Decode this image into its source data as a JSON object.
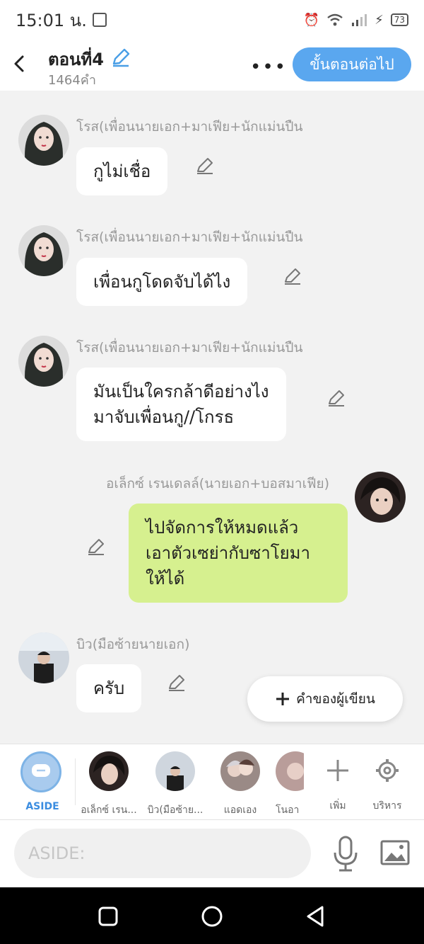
{
  "status": {
    "time": "15:01 น.",
    "battery": "73"
  },
  "header": {
    "title": "ตอนที่4",
    "word_count": "1464คำ",
    "more": "•••",
    "next_label": "ขั้นตอนต่อไป"
  },
  "messages": [
    {
      "name": "โรส(เพื่อนนายเอก+มาเฟีย+นักแม่นปืน",
      "lines": [
        "กูไม่เชื่อ"
      ]
    },
    {
      "name": "โรส(เพื่อนนายเอก+มาเฟีย+นักแม่นปืน",
      "lines": [
        "เพื่อนกูโดดจับได้ไง"
      ]
    },
    {
      "name": "โรส(เพื่อนนายเอก+มาเฟีย+นักแม่นปืน",
      "lines": [
        "มันเป็นใครกล้าดีอย่างไง",
        "มาจับเพื่อนกู//โกรธ"
      ]
    },
    {
      "name": "อเล็กซ์ เรนเดลล์(นายเอก+บอสมาเฟีย)",
      "lines": [
        "ไปจัดการให้หมดแล้ว",
        "เอาตัวเซย่ากับซาโยมา",
        "ให้ได้"
      ]
    },
    {
      "name": "บิว(มือซ้ายนายเอก)",
      "lines": [
        "ครับ"
      ]
    }
  ],
  "fab": {
    "label": "คำของผู้เขียน"
  },
  "picker": {
    "aside": "ASIDE",
    "characters": [
      "อเล็กซ์ เรน...",
      "บิว(มือซ้าย...",
      "แอดเอง",
      "โนอา"
    ],
    "add": "เพิ่ม",
    "manage": "บริหาร"
  },
  "input": {
    "placeholder": "ASIDE:"
  },
  "colors": {
    "accent": "#5aa7ef",
    "my_bubble": "#d6f08f"
  }
}
